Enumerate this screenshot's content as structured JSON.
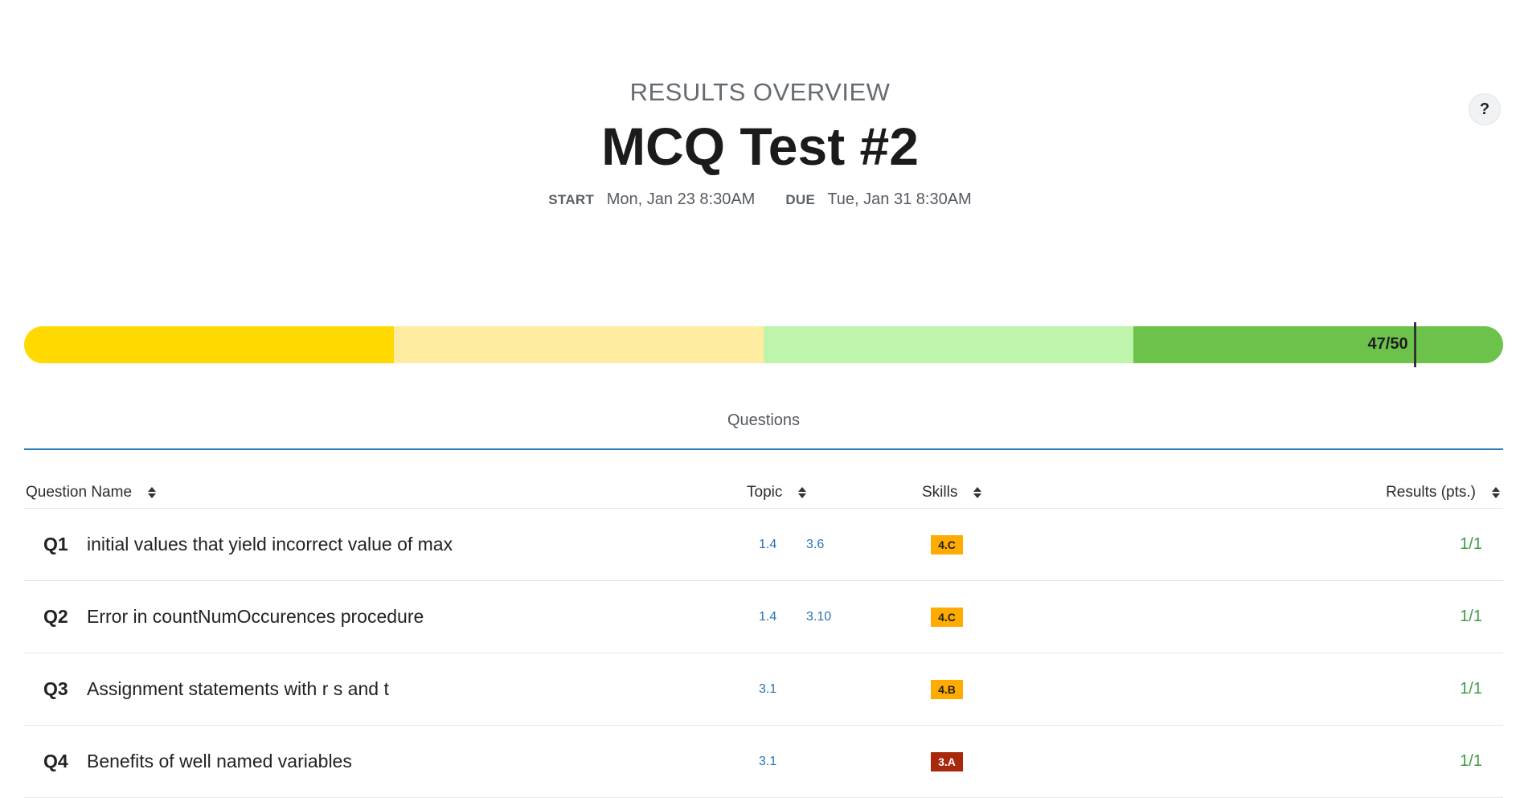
{
  "help": {
    "label": "?"
  },
  "header": {
    "overline": "RESULTS OVERVIEW",
    "title": "MCQ Test #2",
    "start_label": "START",
    "start_value": "Mon, Jan 23 8:30AM",
    "due_label": "DUE",
    "due_value": "Tue, Jan 31 8:30AM"
  },
  "progress": {
    "score_text": "47/50",
    "score": 47,
    "max": 50,
    "segments": [
      {
        "color": "#ffd900"
      },
      {
        "color": "#feeca0"
      },
      {
        "color": "#bff5ab"
      },
      {
        "color": "#6cc24a"
      }
    ]
  },
  "tabs": [
    {
      "label": "Questions",
      "active": true
    }
  ],
  "table": {
    "columns": {
      "question_name": "Question Name",
      "topic": "Topic",
      "skills": "Skills",
      "results": "Results (pts.)"
    },
    "rows": [
      {
        "num": "Q1",
        "name": "initial values that yield incorrect value of max",
        "topic1": "1.4",
        "topic2": "3.6",
        "skill": "4.C",
        "skill_color": "#ffab00",
        "skill_text_color": "#222222",
        "result": "1/1"
      },
      {
        "num": "Q2",
        "name": "Error in countNumOccurences procedure",
        "topic1": "1.4",
        "topic2": "3.10",
        "skill": "4.C",
        "skill_color": "#ffab00",
        "skill_text_color": "#222222",
        "result": "1/1"
      },
      {
        "num": "Q3",
        "name": "Assignment statements with r s and t",
        "topic1": "3.1",
        "topic2": "",
        "skill": "4.B",
        "skill_color": "#ffab00",
        "skill_text_color": "#222222",
        "result": "1/1"
      },
      {
        "num": "Q4",
        "name": "Benefits of well named variables",
        "topic1": "3.1",
        "topic2": "",
        "skill": "3.A",
        "skill_color": "#a8280c",
        "skill_text_color": "#ffffff",
        "result": "1/1"
      }
    ]
  }
}
